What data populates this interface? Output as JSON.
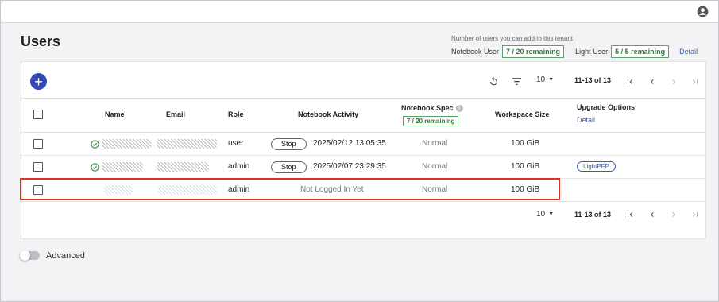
{
  "header": {
    "account_icon": "account-circle-icon"
  },
  "page": {
    "title": "Users"
  },
  "quota": {
    "caption": "Number of users you can add to this tenant",
    "notebook_user_label": "Notebook User",
    "notebook_user_value": "7 / 20 remaining",
    "light_user_label": "Light User",
    "light_user_value": "5 / 5 remaining",
    "detail_link": "Detail"
  },
  "toolbar": {
    "add_icon": "plus-icon",
    "refresh_icon": "refresh-icon",
    "filter_icon": "filter-icon",
    "rows_per_page": "10",
    "range": "11-13 of 13"
  },
  "table": {
    "headers": {
      "name": "Name",
      "email": "Email",
      "role": "Role",
      "notebook_activity": "Notebook Activity",
      "notebook_spec": "Notebook Spec",
      "notebook_spec_badge": "7 / 20 remaining",
      "workspace_size": "Workspace Size",
      "upgrade_options": "Upgrade Options",
      "upgrade_detail": "Detail"
    },
    "rows": [
      {
        "role": "user",
        "stop_label": "Stop",
        "activity": "2025/02/12 13:05:35",
        "spec": "Normal",
        "size": "100 GiB",
        "upgrade": ""
      },
      {
        "role": "admin",
        "stop_label": "Stop",
        "activity": "2025/02/07 23:29:35",
        "spec": "Normal",
        "size": "100 GiB",
        "upgrade": "LightPFP"
      },
      {
        "role": "admin",
        "stop_label": "",
        "activity": "Not Logged In Yet",
        "spec": "Normal",
        "size": "100 GiB",
        "upgrade": ""
      }
    ]
  },
  "footer_pager": {
    "rows_per_page": "10",
    "range": "11-13 of 13"
  },
  "advanced": {
    "label": "Advanced",
    "enabled": false
  },
  "colors": {
    "accent": "#3347b5",
    "remaining_green": "#2f7d3a",
    "highlight": "#e0301e"
  }
}
